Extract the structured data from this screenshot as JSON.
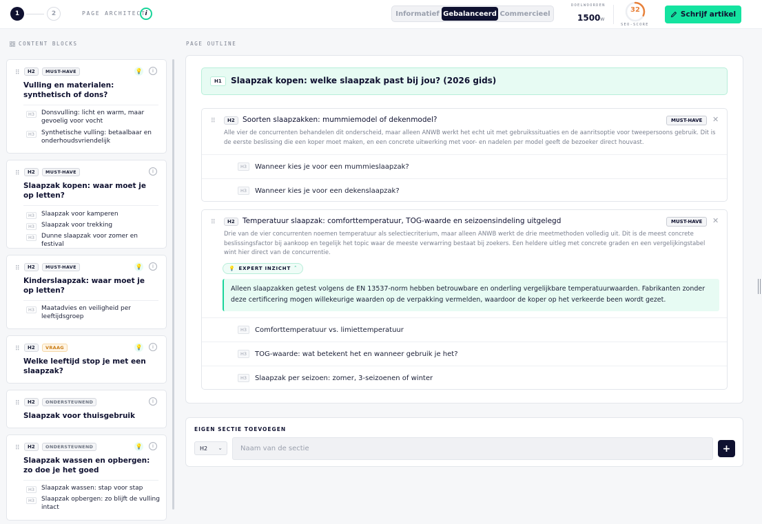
{
  "header": {
    "steps": [
      "1",
      "2"
    ],
    "title": "PAGE ARCHITECT",
    "info_icon": "i",
    "modes": [
      "Informatief",
      "Gebalanceerd",
      "Commercieel"
    ],
    "active_mode": "Gebalanceerd",
    "goal_label": "DOELWOORDEN",
    "goal_value": "1500",
    "goal_unit": "w",
    "seo_score": "32",
    "seo_score_fraction": 0.32,
    "seo_label": "SEO-SCORE",
    "write_button": "Schrijf artikel",
    "colors": {
      "accent": "#14e3a0",
      "dark": "#0f1130",
      "score": "#e8813a"
    }
  },
  "content_blocks": {
    "label": "CONTENT BLOCKS",
    "cards": [
      {
        "level": "H2",
        "tag": "MUST-HAVE",
        "title": "Vulling en materialen: synthetisch of dons?",
        "subs": [
          "Donsvulling: licht en warm, maar gevoelig voor vocht",
          "Synthetische vulling: betaalbaar en onderhoudsvriendelijk"
        ]
      },
      {
        "level": "H2",
        "tag": "MUST-HAVE",
        "title": "Slaapzak kopen: waar moet je op letten?",
        "subs": [
          "Slaapzak voor kamperen",
          "Slaapzak voor trekking",
          "Dunne slaapzak voor zomer en festival"
        ]
      },
      {
        "level": "H2",
        "tag": "MUST-HAVE",
        "title": "Kinderslaapzak: waar moet je op letten?",
        "subs": [
          "Maatadvies en veiligheid per leeftijdsgroep"
        ]
      },
      {
        "level": "H2",
        "tag": "VRAAG",
        "title": "Welke leeftijd stop je met een slaapzak?",
        "subs": []
      },
      {
        "level": "H2",
        "tag": "ONDERSTEUNEND",
        "title": "Slaapzak voor thuisgebruik",
        "subs": []
      },
      {
        "level": "H2",
        "tag": "ONDERSTEUNEND",
        "title": "Slaapzak wassen en opbergen: zo doe je het goed",
        "subs": [
          "Slaapzak wassen: stap voor stap",
          "Slaapzak opbergen: zo blijft de vulling intact"
        ]
      }
    ],
    "sub_level": "H3"
  },
  "outline": {
    "label": "PAGE OUTLINE",
    "h1_level": "H1",
    "h1": "Slaapzak kopen: welke slaapzak past bij jou? (2026 gids)",
    "sections": [
      {
        "level": "H2",
        "title": "Soorten slaapzakken: mummiemodel of dekenmodel?",
        "tag": "MUST-HAVE",
        "description": "Alle vier de concurrenten behandelen dit onderscheid, maar alleen ANWB werkt het echt uit met gebruikssituaties en de aanritsoptie voor tweepersoons gebruik. Dit is de eerste beslissing die een koper moet maken, en een concrete uitwerking met voor- en nadelen per model geeft de bezoeker direct houvast.",
        "subs": [
          "Wanneer kies je voor een mummieslaapzak?",
          "Wanneer kies je voor een dekenslaapzak?"
        ]
      },
      {
        "level": "H2",
        "title": "Temperatuur slaapzak: comforttemperatuur, TOG-waarde en seizoensindeling uitgelegd",
        "tag": "MUST-HAVE",
        "description": "Drie van de vier concurrenten noemen temperatuur als selectiecriterium, maar alleen ANWB werkt de drie meetmethoden volledig uit. Dit is de meest concrete beslissingsfactor bij aankoop en tegelijk het topic waar de meeste verwarring bestaat bij zoekers. Een heldere uitleg met concrete graden en een vergelijkingstabel wint hier direct van de concurrentie.",
        "expert_label": "EXPERT INZICHT",
        "expert_text": "Alleen slaapzakken getest volgens de EN 13537-norm hebben betrouwbare en onderling vergelijkbare temperatuurwaarden. Fabrikanten zonder deze certificering mogen willekeurige waarden op de verpakking vermelden, waardoor de koper op het verkeerde been wordt gezet.",
        "subs": [
          "Comforttemperatuur vs. limiettemperatuur",
          "TOG-waarde: wat betekent het en wanneer gebruik je het?",
          "Slaapzak per seizoen: zomer, 3-seizoenen of winter"
        ]
      }
    ],
    "sub_level": "H3"
  },
  "add_section": {
    "label": "EIGEN SECTIE TOEVOEGEN",
    "level_select": "H2",
    "placeholder": "Naam van de sectie",
    "add_button": "+"
  }
}
